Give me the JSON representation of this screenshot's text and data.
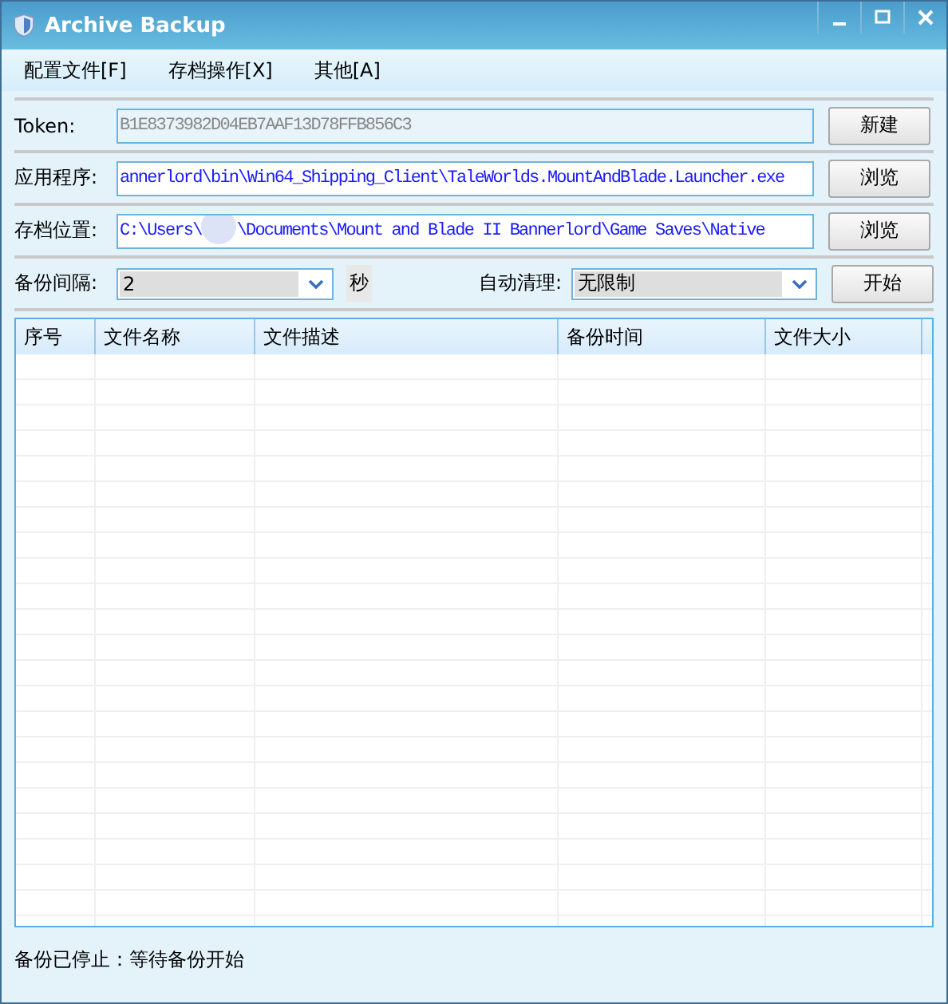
{
  "window": {
    "title": "Archive Backup"
  },
  "menu": [
    {
      "label": "配置文件[F]"
    },
    {
      "label": "存档操作[X]"
    },
    {
      "label": "其他[A]"
    }
  ],
  "token": {
    "label": "Token:",
    "value": "B1E8373982D04EB7AAF13D78FFB856C3",
    "button": "新建"
  },
  "application": {
    "label": "应用程序:",
    "value": "annerlord\\bin\\Win64_Shipping_Client\\TaleWorlds.MountAndBlade.Launcher.exe",
    "button": "浏览"
  },
  "save_location": {
    "label": "存档位置:",
    "value_before": "C:\\Users\\",
    "value_after": "\\Documents\\Mount and Blade II Bannerlord\\Game Saves\\Native",
    "button": "浏览"
  },
  "interval": {
    "label": "备份间隔:",
    "value": "2",
    "unit": "秒"
  },
  "auto_clean": {
    "label": "自动清理:",
    "value": "无限制"
  },
  "start_button": "开始",
  "table": {
    "columns": [
      "序号",
      "文件名称",
      "文件描述",
      "备份时间",
      "文件大小"
    ]
  },
  "status_bar": "备份已停止：等待备份开始"
}
